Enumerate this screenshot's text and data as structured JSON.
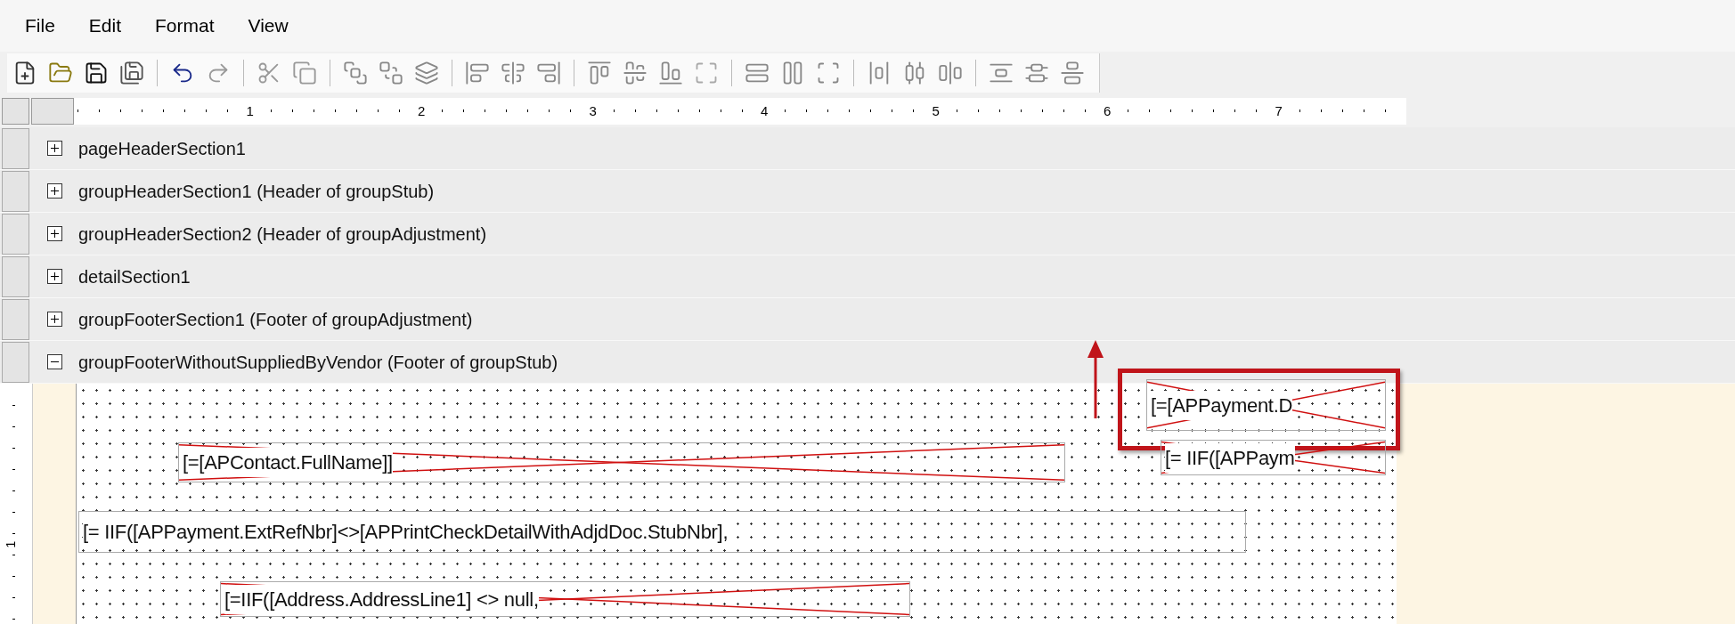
{
  "menu": [
    {
      "label": "File"
    },
    {
      "label": "Edit"
    },
    {
      "label": "Format"
    },
    {
      "label": "View"
    }
  ],
  "ruler": {
    "marks": [
      "1",
      "2",
      "3",
      "4",
      "5",
      "6",
      "7"
    ],
    "vertical_marks": [
      "1"
    ]
  },
  "sections": [
    {
      "label": "pageHeaderSection1",
      "expanded": false
    },
    {
      "label": "groupHeaderSection1 (Header of groupStub)",
      "expanded": false
    },
    {
      "label": "groupHeaderSection2 (Header of groupAdjustment)",
      "expanded": false
    },
    {
      "label": "detailSection1",
      "expanded": false
    },
    {
      "label": "groupFooterSection1 (Footer of groupAdjustment)",
      "expanded": false
    },
    {
      "label": "groupFooterWithoutSuppliedByVendor (Footer of groupStub)",
      "expanded": true
    }
  ],
  "fields": [
    {
      "text": "[=[APPayment.D",
      "crossed": true,
      "highlighted": true
    },
    {
      "text": "[=[APContact.FullName]]",
      "crossed": true,
      "highlighted": false
    },
    {
      "text": "[= IIF([APPaym",
      "crossed": true,
      "highlighted": false
    },
    {
      "text": "[= IIF([APPayment.ExtRefNbr]<>[APPrintCheckDetailWithAdjdDoc.StubNbr],",
      "crossed": false,
      "highlighted": false
    },
    {
      "text": "[=IIF([Address.AddressLine1] <> null,",
      "crossed": true,
      "highlighted": false
    }
  ]
}
